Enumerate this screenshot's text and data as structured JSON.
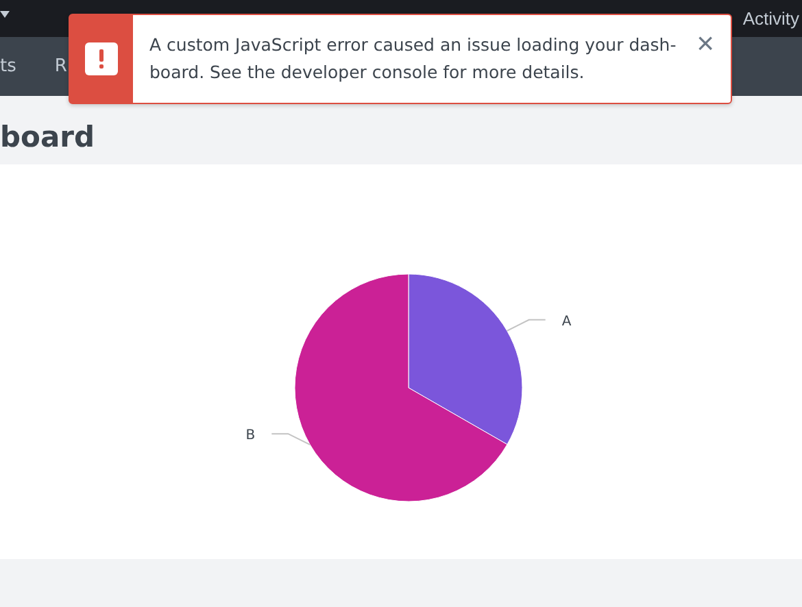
{
  "top_nav": {
    "items": [
      {
        "label": "Activity"
      }
    ]
  },
  "app_bar": {
    "items": [
      "ts",
      "R"
    ]
  },
  "page": {
    "title": "board"
  },
  "toast": {
    "message": "A custom JavaScript error caused an issue loading your dash-board. See the developer console for more details.",
    "close": "×"
  },
  "panel": {
    "chart_data": {
      "type": "pie",
      "categories": [
        "A",
        "B"
      ],
      "series": [
        {
          "values": [
            33.3,
            66.7
          ]
        }
      ],
      "colors": [
        "#7b56db",
        "#cb2196"
      ]
    }
  }
}
